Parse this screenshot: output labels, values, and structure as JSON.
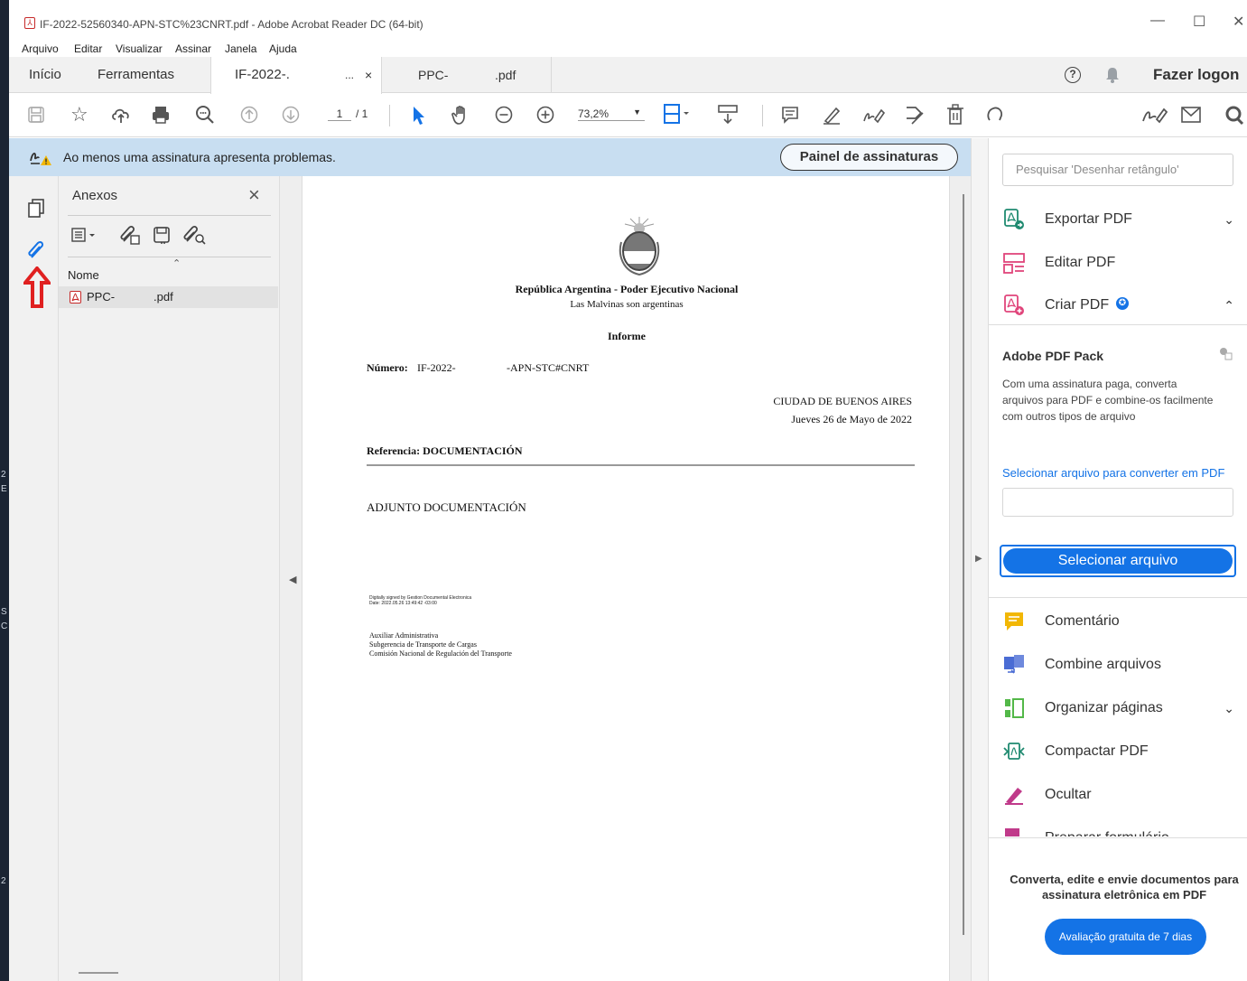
{
  "window": {
    "title": "IF-2022-52560340-APN-STC%23CNRT.pdf - Adobe Acrobat Reader DC (64-bit)",
    "minimize": "—",
    "maximize": "☐",
    "close": "✕"
  },
  "menu": [
    "Arquivo",
    "Editar",
    "Visualizar",
    "Assinar",
    "Janela",
    "Ajuda"
  ],
  "tabs": {
    "home": "Início",
    "tools": "Ferramentas",
    "doc1": "IF-2022-.",
    "doc1_tail": "...",
    "doc1_close": "×",
    "doc2": "PPC-",
    "doc2_ext": ".pdf",
    "login": "Fazer logon"
  },
  "toolbar": {
    "page_current": "1",
    "page_total": "/ 1",
    "zoom": "73,2%"
  },
  "signature_bar": {
    "message": "Ao menos uma assinatura apresenta problemas.",
    "button": "Painel de assinaturas"
  },
  "attachments": {
    "title": "Anexos",
    "close": "×",
    "col_name": "Nome",
    "files": [
      {
        "name": "PPC-",
        "ext": ".pdf"
      }
    ]
  },
  "document": {
    "header1": "República Argentina - Poder Ejecutivo Nacional",
    "header2": "Las Malvinas son argentinas",
    "doc_type": "Informe",
    "number_label": "Número:",
    "number_value": "IF-2022-",
    "number_suffix": "-APN-STC#CNRT",
    "city": "CIUDAD DE BUENOS AIRES",
    "date": "Jueves 26 de Mayo de 2022",
    "reference": "Referencia: DOCUMENTACIÓN",
    "body": "ADJUNTO DOCUMENTACIÓN",
    "sig_line1": "Digitally signed by Gestion Documental Electronica",
    "sig_line2": "Date: 2022.05.26 13:49:42 -03:00",
    "signer1": "Auxiliar Administrativa",
    "signer2": "Subgerencia de Transporte de Cargas",
    "signer3": "Comisión Nacional de Regulación del Transporte"
  },
  "right_panel": {
    "search_placeholder": "Pesquisar 'Desenhar retângulo'",
    "tools_top": [
      {
        "label": "Exportar PDF",
        "icon": "export-pdf-icon",
        "color": "#1f8a70"
      },
      {
        "label": "Editar PDF",
        "icon": "edit-pdf-icon",
        "color": "#e0457b"
      },
      {
        "label": "Criar PDF",
        "icon": "create-pdf-icon",
        "color": "#e0457b"
      }
    ],
    "pack_title": "Adobe PDF Pack",
    "pack_desc": "Com uma assinatura paga, converta arquivos para PDF e combine-os facilmente com outros tipos de arquivo",
    "pack_link": "Selecionar arquivo para converter em PDF",
    "select_button": "Selecionar arquivo",
    "tools_bottom": [
      {
        "label": "Comentário",
        "icon": "comment-icon",
        "color": "#f2b705"
      },
      {
        "label": "Combine arquivos",
        "icon": "combine-files-icon",
        "color": "#4a6cd4"
      },
      {
        "label": "Organizar páginas",
        "icon": "organize-pages-icon",
        "color": "#53b848"
      },
      {
        "label": "Compactar PDF",
        "icon": "compress-pdf-icon",
        "color": "#1f8a70"
      },
      {
        "label": "Ocultar",
        "icon": "redact-icon",
        "color": "#c03a8a"
      },
      {
        "label": "Preparar formulário",
        "icon": "prepare-form-icon",
        "color": "#c03a8a"
      }
    ],
    "promo_text": "Converta, edite e envie documentos para assinatura eletrônica em PDF",
    "trial_button": "Avaliação gratuita de 7 dias"
  },
  "colors": {
    "accent_blue": "#1473e6",
    "sig_bar_bg": "#c8def1",
    "warning_red": "#e02020"
  }
}
